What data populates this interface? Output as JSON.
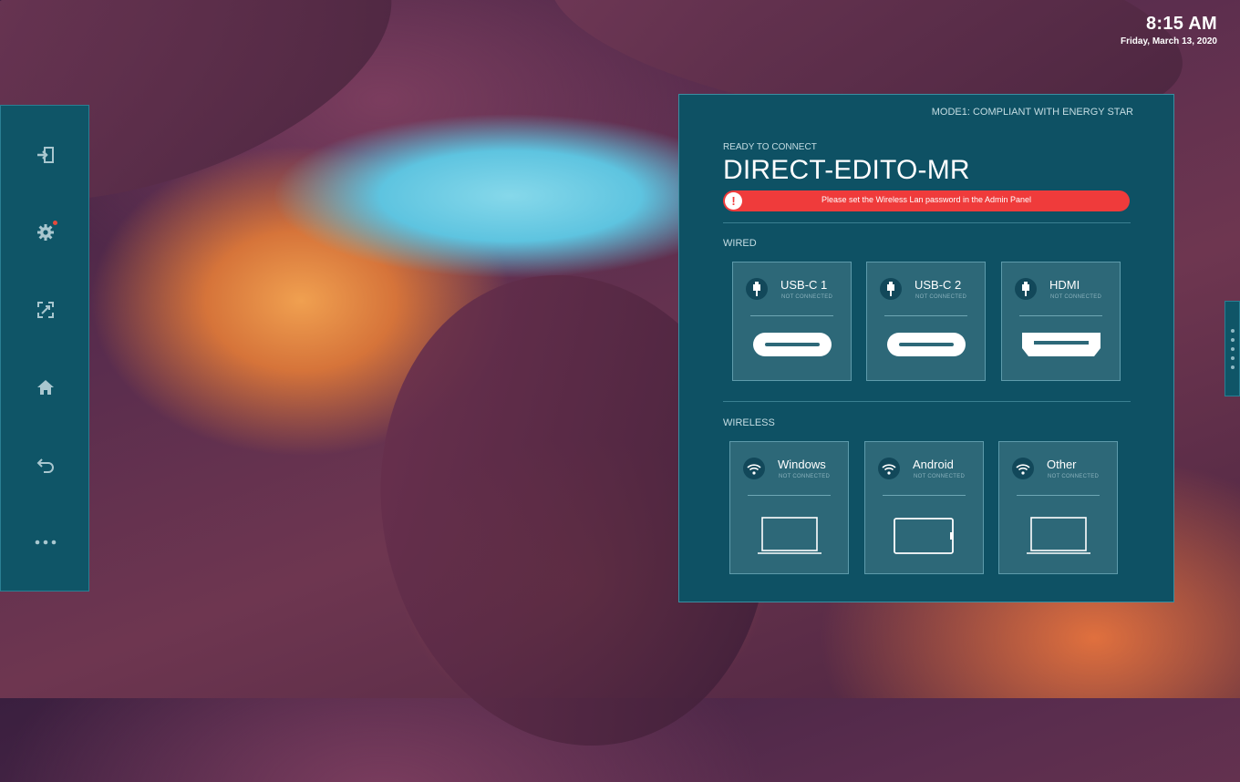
{
  "clock": {
    "time": "8:15 AM",
    "date": "Friday, March 13, 2020"
  },
  "sidebar": {
    "items": [
      {
        "name": "input-icon"
      },
      {
        "name": "settings-icon",
        "has_notification": true
      },
      {
        "name": "screen-capture-icon"
      },
      {
        "name": "home-icon"
      },
      {
        "name": "back-icon"
      },
      {
        "name": "more-icon"
      }
    ]
  },
  "panel": {
    "mode": "MODE1: COMPLIANT WITH ENERGY STAR",
    "ready_label": "READY TO CONNECT",
    "device_name": "DIRECT-EDITO-MR",
    "warning": "Please set the Wireless Lan password in the Admin Panel",
    "wired_label": "WIRED",
    "wireless_label": "WIRELESS",
    "wired": [
      {
        "title": "USB-C 1",
        "status": "NOT CONNECTED",
        "icon": "usb-icon",
        "graphic": "usb-c-port"
      },
      {
        "title": "USB-C 2",
        "status": "NOT CONNECTED",
        "icon": "usb-icon",
        "graphic": "usb-c-port"
      },
      {
        "title": "HDMI",
        "status": "NOT CONNECTED",
        "icon": "usb-icon",
        "graphic": "hdmi-port"
      }
    ],
    "wireless": [
      {
        "title": "Windows",
        "status": "NOT CONNECTED",
        "icon": "wifi-icon",
        "graphic": "laptop"
      },
      {
        "title": "Android",
        "status": "NOT CONNECTED",
        "icon": "wifi-icon",
        "graphic": "tablet"
      },
      {
        "title": "Other",
        "status": "NOT CONNECTED",
        "icon": "wifi-icon",
        "graphic": "laptop"
      }
    ]
  },
  "colors": {
    "panel": "#0e5164",
    "card": "#2d6878",
    "warning": "#ef3b3b",
    "notification": "#e84a3c"
  }
}
